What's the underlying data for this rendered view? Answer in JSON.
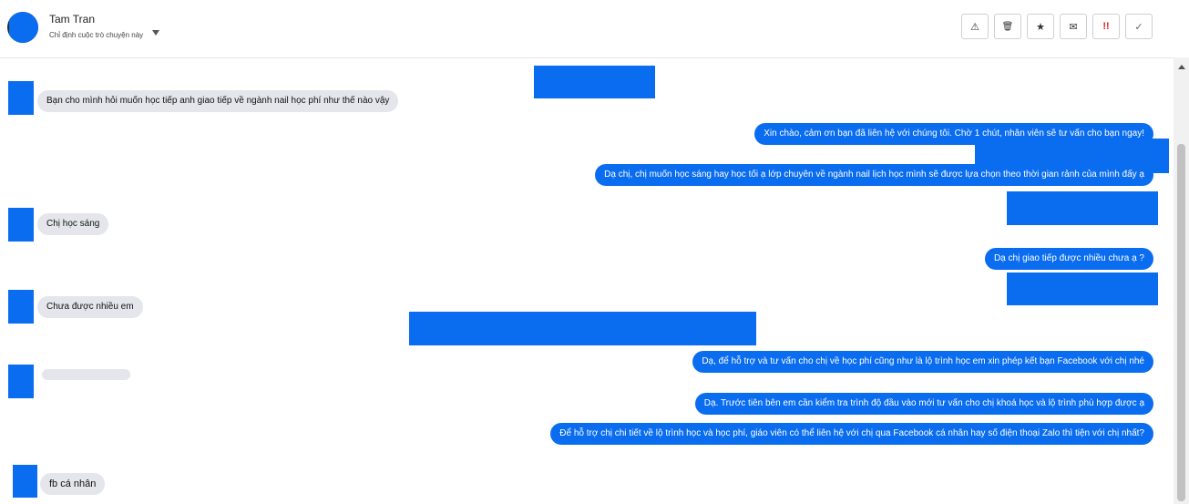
{
  "header": {
    "contact_name": "Tam Tran",
    "assign_label": "Chỉ định cuộc trò chuyện này"
  },
  "toolbar": {
    "spam_icon": "⚠",
    "delete_icon": "🗑",
    "star_icon": "★",
    "mail_icon": "✉",
    "important_icon": "!!",
    "done_icon": "✓"
  },
  "messages": [
    {
      "side": "in",
      "text": "Bạn cho mình hỏi muốn học tiếp anh giao tiếp về ngành nail học phí như thế nào vậy"
    },
    {
      "side": "out",
      "text": "Xin chào, cảm ơn bạn đã liên hệ với chúng tôi. Chờ 1 chút, nhân viên sẽ tư vấn cho bạn ngay!"
    },
    {
      "side": "out",
      "text": "Dạ chị, chị muốn học sáng hay học tối ạ lớp chuyên về ngành nail lịch học mình sẽ được lựa chọn theo thời gian rảnh của mình đấy ạ"
    },
    {
      "side": "in",
      "text": "Chị học sáng"
    },
    {
      "side": "out",
      "text": "Dạ chị giao tiếp được nhiều chưa ạ ?"
    },
    {
      "side": "in",
      "text": "Chưa được nhiều em"
    },
    {
      "side": "out",
      "text": "Dạ, để hỗ trợ và tư vấn cho chị về học phí cũng như là lộ trình học em xin phép kết bạn Facebook với chị nhé"
    },
    {
      "side": "out",
      "text": "Dạ. Trước tiên bên em cần kiểm tra trình độ đầu vào mới tư vấn cho chị khoá học và lộ trình phù hợp được ạ"
    },
    {
      "side": "out",
      "text": "Để hỗ trợ chị chi tiết về lộ trình học và học phí, giáo viên có thể liên hệ với chị qua Facebook cá nhân hay số điện thoại Zalo thì tiện với chị nhất?"
    },
    {
      "side": "in",
      "text": "fb cá nhân"
    }
  ]
}
